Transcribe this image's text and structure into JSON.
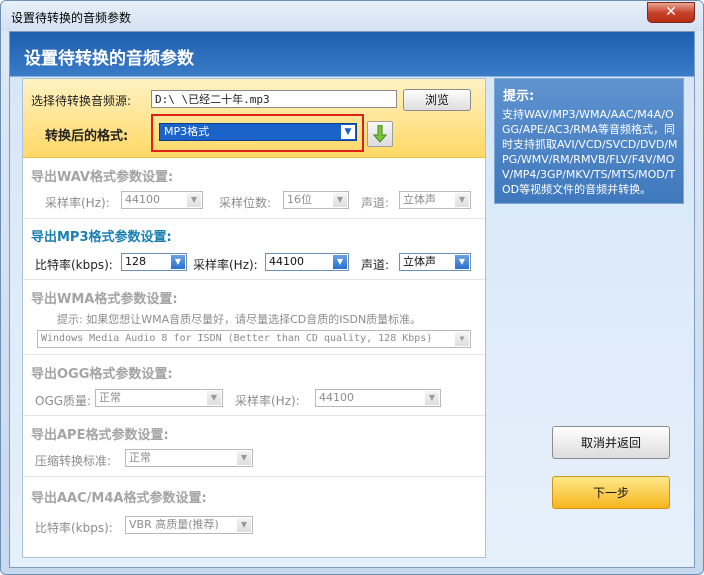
{
  "window": {
    "title": "设置待转换的音频参数",
    "close_glyph": "✕"
  },
  "header": {
    "title": "设置待转换的音频参数"
  },
  "source": {
    "label": "选择待转换音频源:",
    "file_value": "D:\\          \\已经二十年.mp3",
    "browse_label": "浏览"
  },
  "format": {
    "label": "转换后的格式:",
    "selected": "MP3格式"
  },
  "wav": {
    "title": "导出WAV格式参数设置:",
    "sample_rate_label": "采样率(Hz):",
    "sample_rate_value": "44100",
    "bit_depth_label": "采样位数:",
    "bit_depth_value": "16位",
    "channel_label": "声道:",
    "channel_value": "立体声"
  },
  "mp3": {
    "title": "导出MP3格式参数设置:",
    "bitrate_label": "比特率(kbps):",
    "bitrate_value": "128",
    "sample_rate_label": "采样率(Hz):",
    "sample_rate_value": "44100",
    "channel_label": "声道:",
    "channel_value": "立体声"
  },
  "wma": {
    "title": "导出WMA格式参数设置:",
    "hint": "提示: 如果您想让WMA音质尽量好，请尽量选择CD音质的ISDN质量标准。",
    "quality_value": "Windows Media Audio 8 for ISDN (Better than CD quality, 128 Kbps)"
  },
  "ogg": {
    "title": "导出OGG格式参数设置:",
    "quality_label": "OGG质量:",
    "quality_value": "正常",
    "sample_rate_label": "采样率(Hz):",
    "sample_rate_value": "44100"
  },
  "ape": {
    "title": "导出APE格式参数设置:",
    "compress_label": "压缩转换标准:",
    "compress_value": "正常"
  },
  "aac": {
    "title": "导出AAC/M4A格式参数设置:",
    "bitrate_label": "比特率(kbps):",
    "bitrate_value": "VBR 高质量(推荐)"
  },
  "hint_panel": {
    "title": "提示:",
    "text": "支持WAV/MP3/WMA/AAC/M4A/OGG/APE/AC3/RMA等音频格式，同时支持抓取AVI/VCD/SVCD/DVD/MPG/WMV/RM/RMVB/FLV/F4V/MOV/MP4/3GP/MKV/TS/MTS/MOD/TOD等视频文件的音频并转换。"
  },
  "actions": {
    "cancel_label": "取消并返回",
    "next_label": "下一步"
  },
  "icons": {
    "dropdown": "▼"
  },
  "colors": {
    "accent_blue": "#1c63c9",
    "highlight_red": "#e0201a",
    "section_active": "#1a7fb3"
  }
}
